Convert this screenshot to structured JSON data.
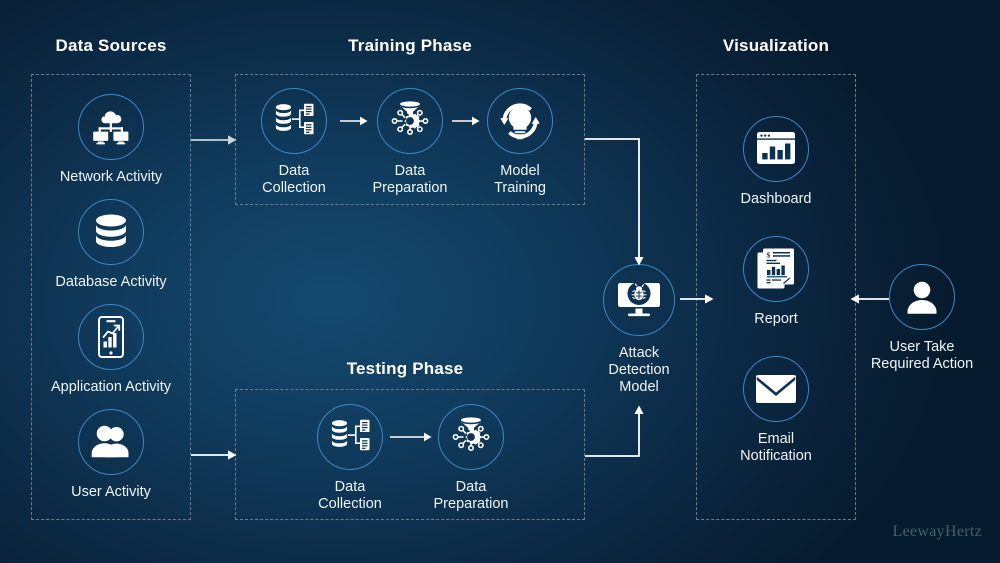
{
  "diagram": {
    "watermark": "LeewayHertz",
    "colors": {
      "background_dark": "#071b2e",
      "background_light": "#14496f",
      "circle_stroke": "#3f86c4",
      "dashed_border": "#6d7c87",
      "icon_fill": "#ffffff",
      "label_text": "#eef4f8",
      "arrow": "#ffffff",
      "watermark_text": "#44606f"
    },
    "sections": [
      {
        "id": "data-sources",
        "title": "Data Sources"
      },
      {
        "id": "training-phase",
        "title": "Training Phase"
      },
      {
        "id": "testing-phase",
        "title": "Testing Phase"
      },
      {
        "id": "visualization",
        "title": "Visualization"
      }
    ],
    "data_sources": {
      "title": "Data Sources",
      "items": [
        {
          "label": "Network Activity",
          "icon": "network-activity-icon"
        },
        {
          "label": "Database Activity",
          "icon": "database-icon"
        },
        {
          "label": "Application Activity",
          "icon": "mobile-chart-icon"
        },
        {
          "label": "User Activity",
          "icon": "users-icon"
        }
      ]
    },
    "training_phase": {
      "title": "Training Phase",
      "items": [
        {
          "label": "Data\nCollection",
          "icon": "data-collection-icon"
        },
        {
          "label": "Data\nPreparation",
          "icon": "data-preparation-icon"
        },
        {
          "label": "Model\nTraining",
          "icon": "model-training-icon"
        }
      ]
    },
    "testing_phase": {
      "title": "Testing Phase",
      "items": [
        {
          "label": "Data\nCollection",
          "icon": "data-collection-icon"
        },
        {
          "label": "Data\nPreparation",
          "icon": "data-preparation-icon"
        }
      ]
    },
    "model": {
      "label": "Attack\nDetection\nModel",
      "icon": "monitor-bug-icon"
    },
    "visualization": {
      "title": "Visualization",
      "items": [
        {
          "label": "Dashboard",
          "icon": "dashboard-icon"
        },
        {
          "label": "Report",
          "icon": "report-icon"
        },
        {
          "label": "Email\nNotification",
          "icon": "email-icon"
        }
      ]
    },
    "user_action": {
      "label": "User Take\nRequired Action",
      "icon": "user-icon"
    }
  }
}
